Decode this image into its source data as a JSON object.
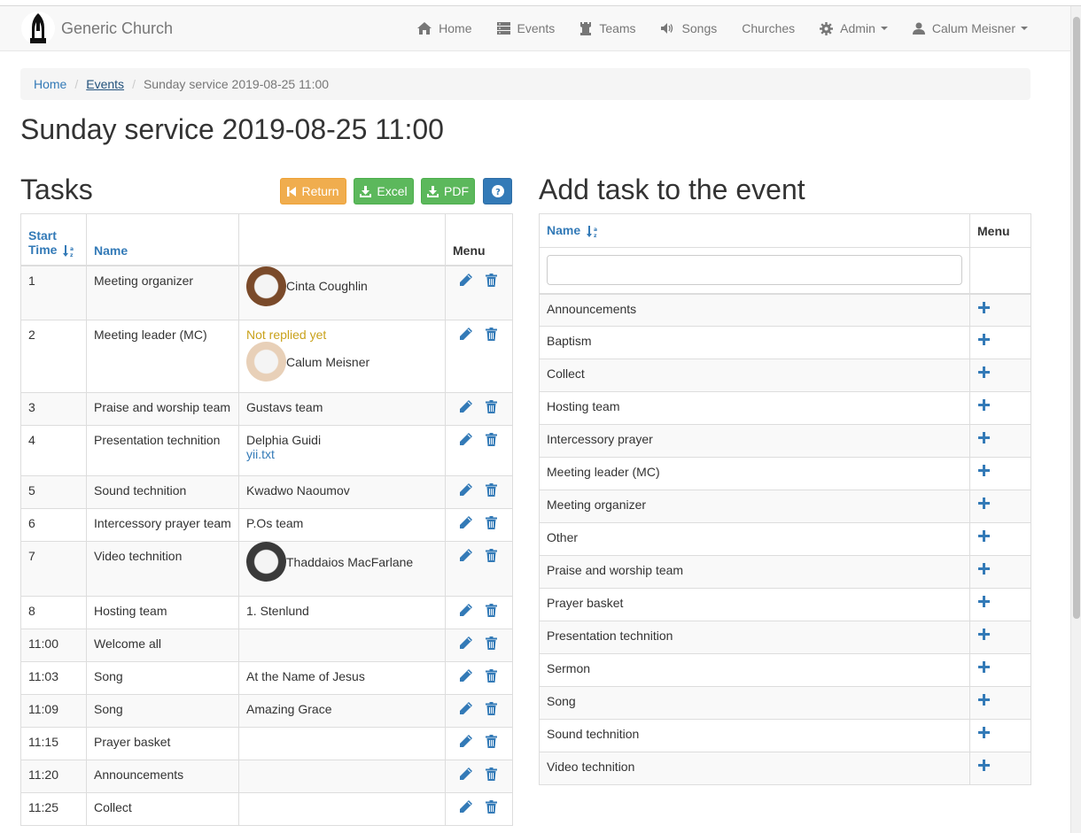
{
  "brand": {
    "name": "Generic Church"
  },
  "nav": {
    "home": "Home",
    "events": "Events",
    "teams": "Teams",
    "songs": "Songs",
    "churches": "Churches",
    "admin": "Admin",
    "user": "Calum Meisner"
  },
  "breadcrumb": {
    "home": "Home",
    "events": "Events",
    "current": "Sunday service 2019-08-25 11:00"
  },
  "page_title": "Sunday service 2019-08-25 11:00",
  "tasks": {
    "heading": "Tasks",
    "buttons": {
      "return": "Return",
      "excel": "Excel",
      "pdf": "PDF"
    },
    "columns": {
      "start": "Start",
      "time": "Time",
      "name": "Name",
      "menu": "Menu"
    },
    "rows": [
      {
        "time": "1",
        "name": "Meeting organizer",
        "person": "Cinta Coughlin",
        "avatar": true
      },
      {
        "time": "2",
        "name": "Meeting leader (MC)",
        "status": "Not replied yet",
        "person": "Calum Meisner",
        "avatar": true
      },
      {
        "time": "3",
        "name": "Praise and worship team",
        "assignee": "Gustavs team"
      },
      {
        "time": "4",
        "name": "Presentation technition",
        "assignee": "Delphia Guidi",
        "link": "yii.txt"
      },
      {
        "time": "5",
        "name": "Sound technition",
        "assignee": "Kwadwo Naoumov"
      },
      {
        "time": "6",
        "name": "Intercessory prayer team",
        "assignee": "P.Os team"
      },
      {
        "time": "7",
        "name": "Video technition",
        "person": "Thaddaios MacFarlane",
        "avatar": true
      },
      {
        "time": "8",
        "name": "Hosting team",
        "assignee": "1. Stenlund"
      },
      {
        "time": "11:00",
        "name": "Welcome all",
        "assignee": ""
      },
      {
        "time": "11:03",
        "name": "Song",
        "assignee": "At the Name of Jesus"
      },
      {
        "time": "11:09",
        "name": "Song",
        "assignee": "Amazing Grace"
      },
      {
        "time": "11:15",
        "name": "Prayer basket",
        "assignee": ""
      },
      {
        "time": "11:20",
        "name": "Announcements",
        "assignee": ""
      },
      {
        "time": "11:25",
        "name": "Collect",
        "assignee": ""
      }
    ]
  },
  "add_task": {
    "heading": "Add task to the event",
    "columns": {
      "name": "Name",
      "menu": "Menu"
    },
    "filter_value": "",
    "items": [
      "Announcements",
      "Baptism",
      "Collect",
      "Hosting team",
      "Intercessory prayer",
      "Meeting leader (MC)",
      "Meeting organizer",
      "Other",
      "Praise and worship team",
      "Prayer basket",
      "Presentation technition",
      "Sermon",
      "Song",
      "Sound technition",
      "Video technition"
    ]
  },
  "colors": {
    "link": "#337ab7",
    "warning": "#f0ad4e",
    "success": "#5cb85c",
    "primary": "#337ab7",
    "not_replied": "#c9a21c"
  }
}
